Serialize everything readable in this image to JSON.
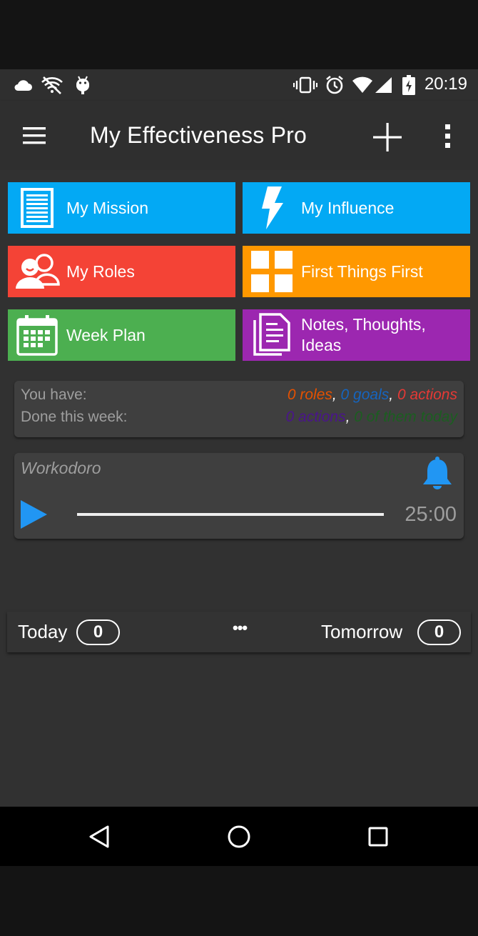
{
  "status_bar": {
    "time": "20:19",
    "left_icons": [
      "cloud-icon",
      "wifi-off-icon",
      "android-icon"
    ],
    "right_icons": [
      "vibrate-icon",
      "alarm-icon",
      "wifi-icon",
      "signal-icon",
      "battery-charging-icon"
    ]
  },
  "app_bar": {
    "title": "My Effectiveness Pro",
    "menu_icon": "hamburger-menu-icon",
    "add_icon": "plus-icon",
    "more_icon": "more-vert-icon"
  },
  "tiles": [
    {
      "label": "My Mission",
      "icon": "document-icon",
      "color": "#03a9f4"
    },
    {
      "label": "My Influence",
      "icon": "lightning-icon",
      "color": "#03a9f4"
    },
    {
      "label": "My Roles",
      "icon": "people-icon",
      "color": "#f44336"
    },
    {
      "label": "First Things First",
      "icon": "grid-icon",
      "color": "#ff9800"
    },
    {
      "label": "Week Plan",
      "icon": "calendar-icon",
      "color": "#4caf50"
    },
    {
      "label": "Notes, Thoughts, Ideas",
      "icon": "notes-icon",
      "color": "#9c27b0"
    }
  ],
  "stats": {
    "you_have_label": "You have:",
    "done_label": "Done this week:",
    "roles": "0 roles",
    "goals": "0 goals",
    "actions": "0 actions",
    "week_actions": "0 actions",
    "today": "0 of them today",
    "sep": ", ",
    "colors": {
      "roles": "#e65100",
      "goals": "#1565c0",
      "actions": "#e53935",
      "week_actions": "#4a148c",
      "today": "#1b5e20"
    }
  },
  "timer": {
    "title": "Workodoro",
    "time": "25:00",
    "bell_icon": "bell-icon",
    "play_icon": "play-icon",
    "accent": "#2196f3"
  },
  "counts": {
    "today_label": "Today",
    "today_count": "0",
    "middle": "•••",
    "tomorrow_label": "Tomorrow",
    "tomorrow_count": "0"
  },
  "nav": [
    "back-icon",
    "home-icon",
    "recents-icon"
  ]
}
